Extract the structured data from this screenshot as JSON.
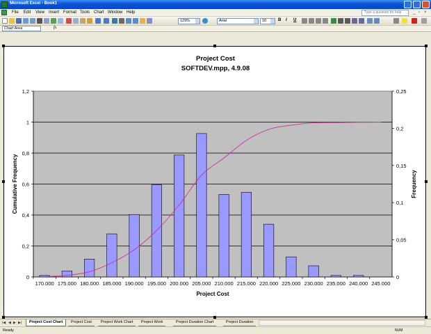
{
  "window": {
    "title": "Microsoft Excel - Book1"
  },
  "menu": {
    "items": [
      "File",
      "Edit",
      "View",
      "Insert",
      "Format",
      "Tools",
      "Chart",
      "Window",
      "Help"
    ],
    "help_placeholder": "Type a question for help"
  },
  "toolbar": {
    "zoom": "129%",
    "font": "Arial",
    "font_size": "10",
    "bold": "B",
    "italic": "I",
    "underline": "U"
  },
  "formula_bar": {
    "name_box": "Chart Area",
    "fx": "fx"
  },
  "chart": {
    "title_line1": "Project Cost",
    "title_line2": "SOFTDEV.mpp, 4.9.08"
  },
  "chart_data": {
    "type": "bar",
    "title": "Project Cost SOFTDEV.mpp, 4.9.08",
    "xlabel": "Project Cost",
    "ylabel": "Cumulative Frequency",
    "y2label": "Frequency",
    "categories": [
      "170.000",
      "175.000",
      "180.000",
      "185.000",
      "190.000",
      "195.000",
      "200.000",
      "205.000",
      "210.000",
      "215.000",
      "220.000",
      "225.000",
      "230.000",
      "235.000",
      "240.000",
      "245.000"
    ],
    "y_ticks": [
      "0",
      "0,2",
      "0,4",
      "0,6",
      "0,8",
      "1",
      "1,2"
    ],
    "y2_ticks": [
      "0",
      "0,05",
      "0,1",
      "0,15",
      "0,2",
      "0,25"
    ],
    "ylim": [
      0,
      1.2
    ],
    "y2lim": [
      0,
      0.25
    ],
    "grid": true,
    "series": [
      {
        "name": "Frequency",
        "type": "bar",
        "axis": "right",
        "color": "#9999ff",
        "values": [
          0.002,
          0.008,
          0.024,
          0.058,
          0.084,
          0.124,
          0.164,
          0.193,
          0.111,
          0.114,
          0.071,
          0.027,
          0.015,
          0.002,
          0.002,
          0
        ]
      },
      {
        "name": "Cumulative Frequency",
        "type": "line",
        "axis": "left",
        "color": "#cc3399",
        "values": [
          0.002,
          0.01,
          0.034,
          0.092,
          0.176,
          0.3,
          0.464,
          0.657,
          0.768,
          0.882,
          0.953,
          0.98,
          0.995,
          0.997,
          0.999,
          1.0
        ]
      }
    ],
    "plot_background": "#c0c0c0"
  },
  "tabs": [
    "Project Cost Chart",
    "Project Cost",
    "Project Work Chart",
    "Project Work",
    "Project Duration Chart",
    "Project Duration"
  ],
  "active_tab": 0,
  "status": {
    "text": "Ready",
    "num": "NUM"
  }
}
